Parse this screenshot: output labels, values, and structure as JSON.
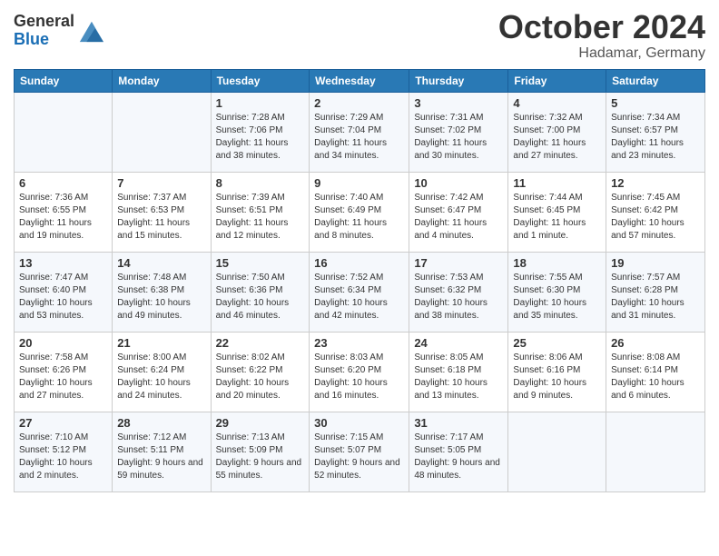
{
  "header": {
    "logo_general": "General",
    "logo_blue": "Blue",
    "title": "October 2024",
    "subtitle": "Hadamar, Germany"
  },
  "weekdays": [
    "Sunday",
    "Monday",
    "Tuesday",
    "Wednesday",
    "Thursday",
    "Friday",
    "Saturday"
  ],
  "weeks": [
    [
      {
        "day": "",
        "sunrise": "",
        "sunset": "",
        "daylight": ""
      },
      {
        "day": "",
        "sunrise": "",
        "sunset": "",
        "daylight": ""
      },
      {
        "day": "1",
        "sunrise": "Sunrise: 7:28 AM",
        "sunset": "Sunset: 7:06 PM",
        "daylight": "Daylight: 11 hours and 38 minutes."
      },
      {
        "day": "2",
        "sunrise": "Sunrise: 7:29 AM",
        "sunset": "Sunset: 7:04 PM",
        "daylight": "Daylight: 11 hours and 34 minutes."
      },
      {
        "day": "3",
        "sunrise": "Sunrise: 7:31 AM",
        "sunset": "Sunset: 7:02 PM",
        "daylight": "Daylight: 11 hours and 30 minutes."
      },
      {
        "day": "4",
        "sunrise": "Sunrise: 7:32 AM",
        "sunset": "Sunset: 7:00 PM",
        "daylight": "Daylight: 11 hours and 27 minutes."
      },
      {
        "day": "5",
        "sunrise": "Sunrise: 7:34 AM",
        "sunset": "Sunset: 6:57 PM",
        "daylight": "Daylight: 11 hours and 23 minutes."
      }
    ],
    [
      {
        "day": "6",
        "sunrise": "Sunrise: 7:36 AM",
        "sunset": "Sunset: 6:55 PM",
        "daylight": "Daylight: 11 hours and 19 minutes."
      },
      {
        "day": "7",
        "sunrise": "Sunrise: 7:37 AM",
        "sunset": "Sunset: 6:53 PM",
        "daylight": "Daylight: 11 hours and 15 minutes."
      },
      {
        "day": "8",
        "sunrise": "Sunrise: 7:39 AM",
        "sunset": "Sunset: 6:51 PM",
        "daylight": "Daylight: 11 hours and 12 minutes."
      },
      {
        "day": "9",
        "sunrise": "Sunrise: 7:40 AM",
        "sunset": "Sunset: 6:49 PM",
        "daylight": "Daylight: 11 hours and 8 minutes."
      },
      {
        "day": "10",
        "sunrise": "Sunrise: 7:42 AM",
        "sunset": "Sunset: 6:47 PM",
        "daylight": "Daylight: 11 hours and 4 minutes."
      },
      {
        "day": "11",
        "sunrise": "Sunrise: 7:44 AM",
        "sunset": "Sunset: 6:45 PM",
        "daylight": "Daylight: 11 hours and 1 minute."
      },
      {
        "day": "12",
        "sunrise": "Sunrise: 7:45 AM",
        "sunset": "Sunset: 6:42 PM",
        "daylight": "Daylight: 10 hours and 57 minutes."
      }
    ],
    [
      {
        "day": "13",
        "sunrise": "Sunrise: 7:47 AM",
        "sunset": "Sunset: 6:40 PM",
        "daylight": "Daylight: 10 hours and 53 minutes."
      },
      {
        "day": "14",
        "sunrise": "Sunrise: 7:48 AM",
        "sunset": "Sunset: 6:38 PM",
        "daylight": "Daylight: 10 hours and 49 minutes."
      },
      {
        "day": "15",
        "sunrise": "Sunrise: 7:50 AM",
        "sunset": "Sunset: 6:36 PM",
        "daylight": "Daylight: 10 hours and 46 minutes."
      },
      {
        "day": "16",
        "sunrise": "Sunrise: 7:52 AM",
        "sunset": "Sunset: 6:34 PM",
        "daylight": "Daylight: 10 hours and 42 minutes."
      },
      {
        "day": "17",
        "sunrise": "Sunrise: 7:53 AM",
        "sunset": "Sunset: 6:32 PM",
        "daylight": "Daylight: 10 hours and 38 minutes."
      },
      {
        "day": "18",
        "sunrise": "Sunrise: 7:55 AM",
        "sunset": "Sunset: 6:30 PM",
        "daylight": "Daylight: 10 hours and 35 minutes."
      },
      {
        "day": "19",
        "sunrise": "Sunrise: 7:57 AM",
        "sunset": "Sunset: 6:28 PM",
        "daylight": "Daylight: 10 hours and 31 minutes."
      }
    ],
    [
      {
        "day": "20",
        "sunrise": "Sunrise: 7:58 AM",
        "sunset": "Sunset: 6:26 PM",
        "daylight": "Daylight: 10 hours and 27 minutes."
      },
      {
        "day": "21",
        "sunrise": "Sunrise: 8:00 AM",
        "sunset": "Sunset: 6:24 PM",
        "daylight": "Daylight: 10 hours and 24 minutes."
      },
      {
        "day": "22",
        "sunrise": "Sunrise: 8:02 AM",
        "sunset": "Sunset: 6:22 PM",
        "daylight": "Daylight: 10 hours and 20 minutes."
      },
      {
        "day": "23",
        "sunrise": "Sunrise: 8:03 AM",
        "sunset": "Sunset: 6:20 PM",
        "daylight": "Daylight: 10 hours and 16 minutes."
      },
      {
        "day": "24",
        "sunrise": "Sunrise: 8:05 AM",
        "sunset": "Sunset: 6:18 PM",
        "daylight": "Daylight: 10 hours and 13 minutes."
      },
      {
        "day": "25",
        "sunrise": "Sunrise: 8:06 AM",
        "sunset": "Sunset: 6:16 PM",
        "daylight": "Daylight: 10 hours and 9 minutes."
      },
      {
        "day": "26",
        "sunrise": "Sunrise: 8:08 AM",
        "sunset": "Sunset: 6:14 PM",
        "daylight": "Daylight: 10 hours and 6 minutes."
      }
    ],
    [
      {
        "day": "27",
        "sunrise": "Sunrise: 7:10 AM",
        "sunset": "Sunset: 5:12 PM",
        "daylight": "Daylight: 10 hours and 2 minutes."
      },
      {
        "day": "28",
        "sunrise": "Sunrise: 7:12 AM",
        "sunset": "Sunset: 5:11 PM",
        "daylight": "Daylight: 9 hours and 59 minutes."
      },
      {
        "day": "29",
        "sunrise": "Sunrise: 7:13 AM",
        "sunset": "Sunset: 5:09 PM",
        "daylight": "Daylight: 9 hours and 55 minutes."
      },
      {
        "day": "30",
        "sunrise": "Sunrise: 7:15 AM",
        "sunset": "Sunset: 5:07 PM",
        "daylight": "Daylight: 9 hours and 52 minutes."
      },
      {
        "day": "31",
        "sunrise": "Sunrise: 7:17 AM",
        "sunset": "Sunset: 5:05 PM",
        "daylight": "Daylight: 9 hours and 48 minutes."
      },
      {
        "day": "",
        "sunrise": "",
        "sunset": "",
        "daylight": ""
      },
      {
        "day": "",
        "sunrise": "",
        "sunset": "",
        "daylight": ""
      }
    ]
  ]
}
